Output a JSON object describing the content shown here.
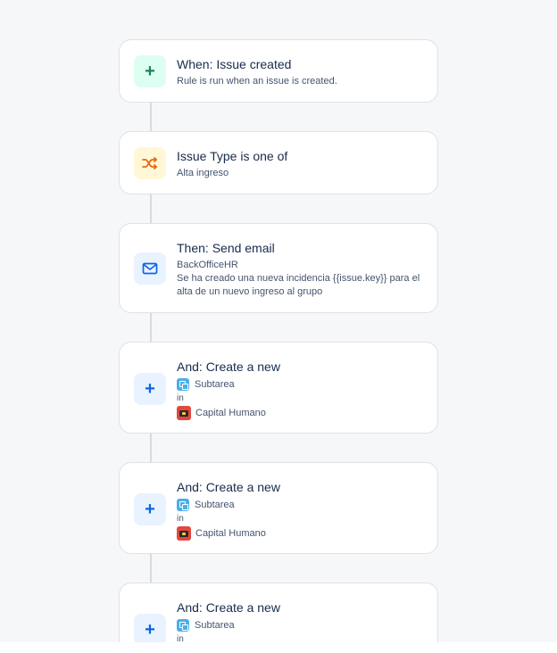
{
  "rule_steps": [
    {
      "kind": "trigger",
      "title": "When: Issue created",
      "subtitle": "Rule is run when an issue is created."
    },
    {
      "kind": "condition",
      "title": "Issue Type is one of",
      "subtitle": "Alta ingreso"
    },
    {
      "kind": "action-email",
      "title": "Then: Send email",
      "recipient": "BackOfficeHR",
      "message": "Se ha creado una nueva incidencia {{issue.key}} para el alta de un nuevo ingreso al grupo"
    },
    {
      "kind": "action-create",
      "title": "And: Create a new",
      "issue_type": "Subtarea",
      "in_label": "in",
      "project": "Capital Humano"
    },
    {
      "kind": "action-create",
      "title": "And: Create a new",
      "issue_type": "Subtarea",
      "in_label": "in",
      "project": "Capital Humano"
    },
    {
      "kind": "action-create",
      "title": "And: Create a new",
      "issue_type": "Subtarea",
      "in_label": "in"
    }
  ],
  "icons": {
    "trigger": "plus-icon",
    "condition": "branch-shuffle-icon",
    "email": "envelope-icon",
    "create": "plus-icon",
    "issue_type": "subtask-icon",
    "project": "project-avatar-icon"
  },
  "colors": {
    "background": "#f6f7f9",
    "card_border": "#dfe1e6",
    "trigger_green": "#1f845a",
    "condition_orange": "#e56910",
    "action_blue": "#0c66e4"
  }
}
